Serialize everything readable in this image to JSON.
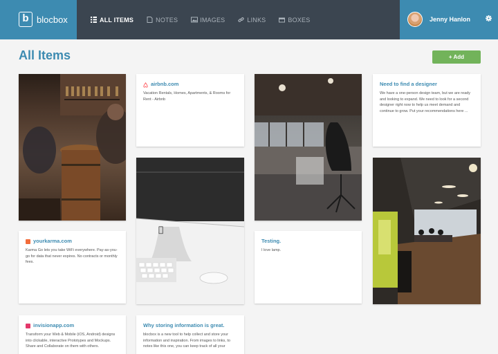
{
  "brand": {
    "name": "blocbox",
    "logo_letter": "b"
  },
  "nav": [
    {
      "label": "ALL ITEMS",
      "icon": "grid-icon",
      "active": true
    },
    {
      "label": "NOTES",
      "icon": "note-icon",
      "active": false
    },
    {
      "label": "IMAGES",
      "icon": "image-icon",
      "active": false
    },
    {
      "label": "LINKS",
      "icon": "link-icon",
      "active": false
    },
    {
      "label": "BOXES",
      "icon": "box-icon",
      "active": false
    }
  ],
  "user": {
    "name": "Jenny Hanlon"
  },
  "page": {
    "title": "All Items",
    "add_label": "+ Add"
  },
  "cards": {
    "airbnb": {
      "title": "airbnb.com",
      "desc": "Vacation Rentals, Homes, Apartments, & Rooms for Rent - Airbnb"
    },
    "designer": {
      "title": "Need to find a designer",
      "desc": "We have a one-person design team, but we are ready and looking to expand. We need to look for a second designer right now to help us meet demand and continue to grow. Put your recommendations here ..."
    },
    "yourkarma": {
      "title": "yourkarma.com",
      "desc": "Karma Go lets you take WiFi everywhere. Pay-as-you-go for data that never expires. No contracts or monthly fees."
    },
    "testing": {
      "title": "Testing.",
      "desc": "I love lamp."
    },
    "invision": {
      "title": "invisionapp.com",
      "desc": "Transform your Web & Mobile (iOS, Android) designs into clickable, interactive Prototypes and Mockups. Share and Collaborate on them with others."
    },
    "storing": {
      "title": "Why storing information is great.",
      "desc": "blocbox is a new tool to help collect and store your information and inspiration. From images to links, to notes like this one, you can keep track of all your"
    }
  },
  "colors": {
    "accent": "#3d8bb1",
    "navbar": "#3b4550",
    "add_button": "#72b35a",
    "airbnb": "#ff5a5f",
    "karma": "#f26c3a",
    "invision": "#e3386a"
  }
}
